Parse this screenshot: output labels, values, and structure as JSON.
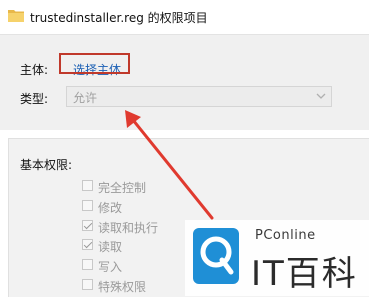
{
  "window": {
    "title": "trustedinstaller.reg 的权限项目",
    "icon": "folder-icon"
  },
  "owner": {
    "label": "主体:",
    "link": "选择主体"
  },
  "type": {
    "label": "类型:",
    "value": "允许",
    "icon": "chevron-down-icon"
  },
  "permissions": {
    "title": "基本权限:",
    "items": [
      {
        "label": "完全控制",
        "checked": false
      },
      {
        "label": "修改",
        "checked": false
      },
      {
        "label": "读取和执行",
        "checked": true
      },
      {
        "label": "读取",
        "checked": true
      },
      {
        "label": "写入",
        "checked": false
      },
      {
        "label": "特殊权限",
        "checked": false
      }
    ]
  },
  "annotation": {
    "color": "#e03a2f",
    "highlight_color": "#c0392b"
  },
  "watermark": {
    "small": "PConline",
    "big": "IT百科",
    "icon": "pconline-logo"
  }
}
